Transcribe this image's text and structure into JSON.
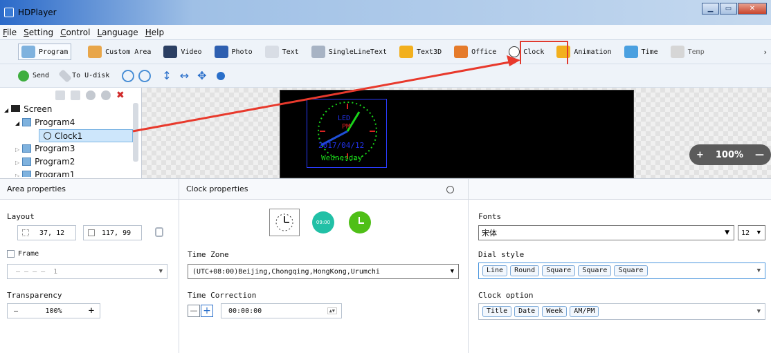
{
  "window": {
    "title": "HDPlayer",
    "min": "▁",
    "max": "▭",
    "close": "✕"
  },
  "menu": [
    "File",
    "Setting",
    "Control",
    "Language",
    "Help"
  ],
  "toolbar": [
    {
      "label": "Program",
      "icon": "program-icon",
      "color": "#7fb2de"
    },
    {
      "label": "Custom Area",
      "icon": "custom-area-icon",
      "color": "#e8a64a"
    },
    {
      "label": "Video",
      "icon": "video-icon",
      "color": "#2b3f63"
    },
    {
      "label": "Photo",
      "icon": "photo-icon",
      "color": "#2e5fb0"
    },
    {
      "label": "Text",
      "icon": "text-icon",
      "color": "#d8dde5"
    },
    {
      "label": "SingleLineText",
      "icon": "single-line-text-icon",
      "color": "#a7b3c4"
    },
    {
      "label": "Text3D",
      "icon": "text3d-icon",
      "color": "#f2b01e"
    },
    {
      "label": "Office",
      "icon": "office-icon",
      "color": "#e57b2b"
    },
    {
      "label": "Clock",
      "icon": "clock-icon",
      "color": "#ffffff"
    },
    {
      "label": "Animation",
      "icon": "animation-icon",
      "color": "#f2b01e"
    },
    {
      "label": "Time",
      "icon": "time-icon",
      "color": "#4aa0e0"
    },
    {
      "label": "Temp",
      "icon": "temp-icon",
      "color": "#d6d6d6"
    }
  ],
  "toolbar2": {
    "send": "Send",
    "udisk": "To U-disk"
  },
  "tree": {
    "screen": "Screen",
    "program4": "Program4",
    "clock1": "Clock1",
    "program3": "Program3",
    "program2": "Program2",
    "program1": "Program1"
  },
  "screen_preview": {
    "led": "LED",
    "pm": "PM",
    "date": "2017/04/12",
    "week": "Wednesday",
    "zoom": "100%"
  },
  "area": {
    "title": "Area properties",
    "layout": "Layout",
    "x": "37, 12",
    "size": "117, 99",
    "frame": "Frame",
    "frame_value": "1",
    "transparency": "Transparency",
    "transparency_value": "100%"
  },
  "clockprops": {
    "title": "Clock properties",
    "digital": "09:00",
    "timezone_label": "Time Zone",
    "timezone": "(UTC+08:00)Beijing,Chongqing,HongKong,Urumchi",
    "correction_label": "Time Correction",
    "correction": "00:00:00"
  },
  "right": {
    "fonts_label": "Fonts",
    "font": "宋体",
    "size": "12",
    "dial_label": "Dial style",
    "dial": [
      "Line",
      "Round",
      "Square",
      "Square",
      "Square"
    ],
    "option_label": "Clock option",
    "options": [
      "Title",
      "Date",
      "Week",
      "AM/PM"
    ]
  },
  "colors": {
    "accent": "#e03a2e",
    "teal": "#21c0a6",
    "green": "#4fbf17",
    "blue": "#1f4fd6"
  }
}
